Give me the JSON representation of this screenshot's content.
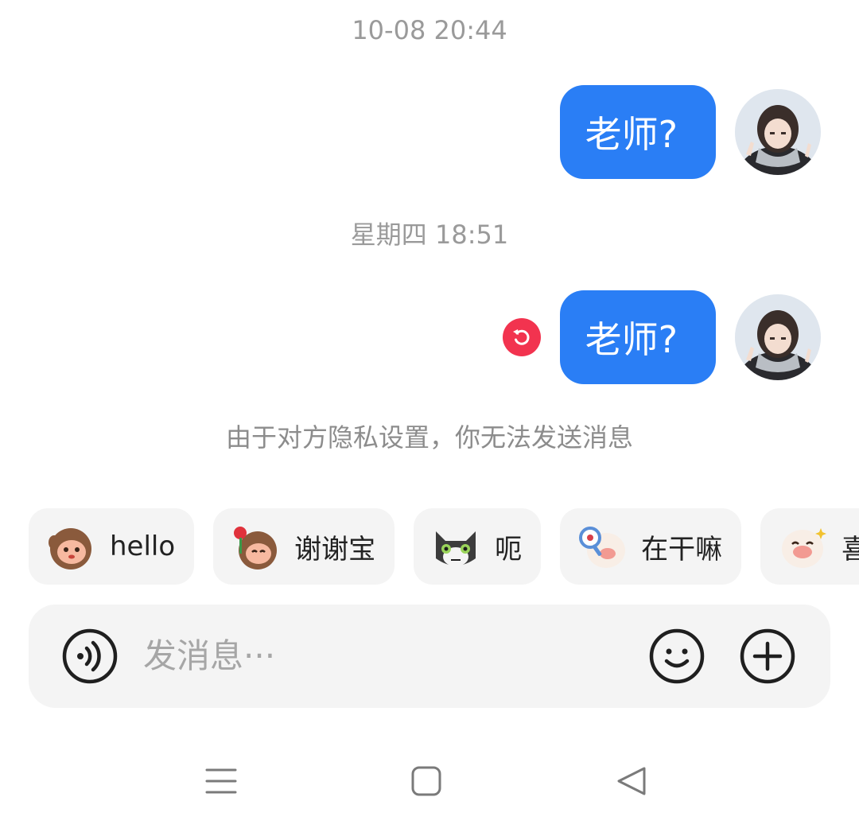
{
  "messages": [
    {
      "timestamp": "10-08 20:44",
      "text": "老师?",
      "failed": false
    },
    {
      "timestamp": "星期四 18:51",
      "text": "老师?",
      "failed": true
    }
  ],
  "system_note": "由于对方隐私设置，你无法发送消息",
  "quick_replies": [
    {
      "label": "hello",
      "icon": "monkey-wave-sticker"
    },
    {
      "label": "谢谢宝",
      "icon": "monkey-rose-sticker"
    },
    {
      "label": "呃",
      "icon": "cat-speechless-sticker"
    },
    {
      "label": "在干嘛",
      "icon": "sheep-magnifier-sticker"
    },
    {
      "label": "喜",
      "icon": "sheep-happy-sticker"
    }
  ],
  "input": {
    "placeholder": "发消息···",
    "voice_icon": "voice-icon",
    "emoji_icon": "emoji-icon",
    "more_icon": "plus-circle-icon"
  },
  "colors": {
    "bubble": "#2a7ef5",
    "retry": "#f2334f",
    "timestamp": "#9a9a9a"
  },
  "navigation": [
    "menu-icon",
    "home-icon",
    "back-icon"
  ]
}
